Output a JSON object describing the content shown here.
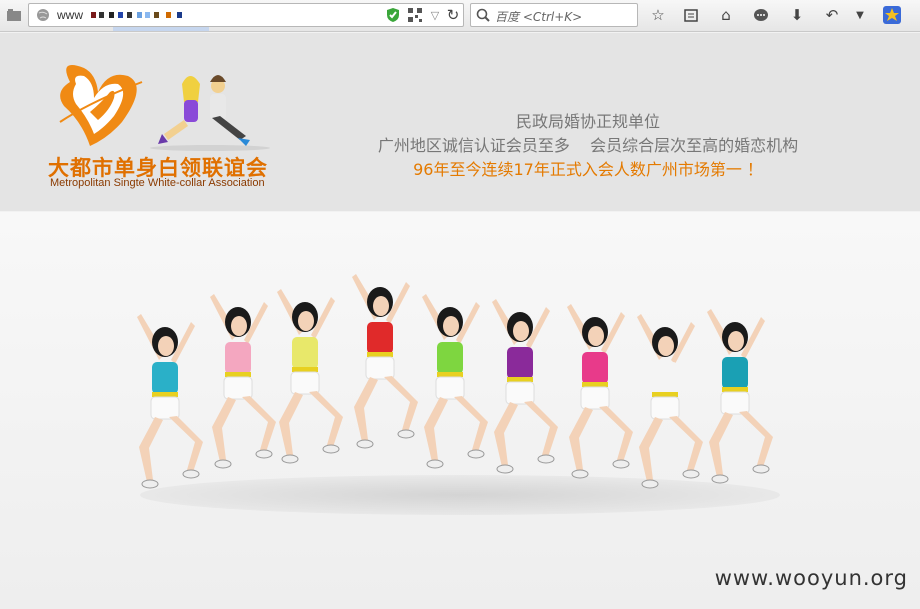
{
  "browser": {
    "url_prefix": "www",
    "search_placeholder": "百度 <Ctrl+K>",
    "icons": [
      "tabs-icon",
      "globe-icon",
      "shield-icon",
      "qr-icon",
      "dropdown-icon",
      "reload-icon",
      "search-icon",
      "star-icon",
      "reader-icon",
      "home-icon",
      "chat-icon",
      "download-icon",
      "back-icon",
      "menu-icon",
      "addon-icon"
    ]
  },
  "header": {
    "logo_cn": "大都市单身白领联谊会",
    "logo_en": "Metropolitan Singte White-collar Association",
    "slogan_line1": "民政局婚协正规单位",
    "slogan_line2": "广州地区诚信认证会员至多    会员综合层次至高的婚恋机构",
    "slogan_line3": "96年至今连续17年正式入会人数广州市场第一 ！"
  },
  "hero": {
    "watermark": "www.wooyun.org",
    "dancer_shirts": [
      "#2ab0c8",
      "#f4a7c0",
      "#e8e86a",
      "#e02a2a",
      "#7ed640",
      "#8a2a9a",
      "#e83a8a",
      "#f4f4f4",
      "#1aa0b4"
    ],
    "accent": "#e07000"
  }
}
